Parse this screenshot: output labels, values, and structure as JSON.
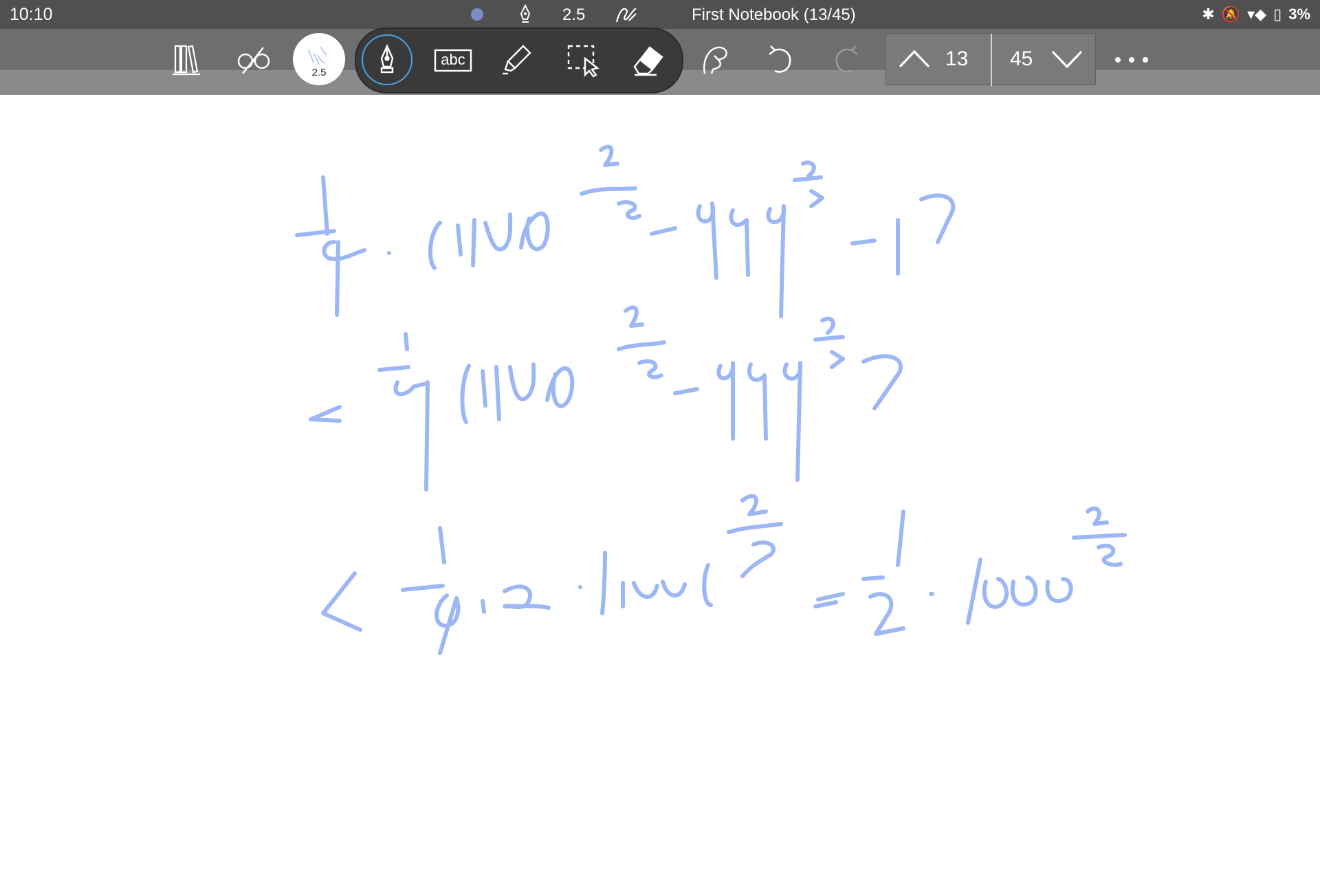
{
  "status_bar": {
    "time": "10:10",
    "pen_size": "2.5",
    "notebook_title": "First Notebook (13/45)",
    "battery": "3%",
    "icons": [
      "dot-indicator",
      "pen-icon",
      "signature-icon",
      "bluetooth-icon",
      "bell-off-icon",
      "wifi-icon",
      "battery-icon"
    ]
  },
  "toolbar": {
    "pen_preview_value": "2.5",
    "text_tool_label": "abc",
    "icons": [
      "library-icon",
      "read-mode-icon",
      "pen-tool-icon",
      "text-tool-icon",
      "highlighter-icon",
      "lasso-select-icon",
      "eraser-icon",
      "hand-icon",
      "undo-icon",
      "redo-icon",
      "more-icon"
    ]
  },
  "pager": {
    "current_page": "13",
    "total_pages": "45"
  },
  "colors": {
    "ink": "#9db7f5",
    "active_ring": "#4aa3e6"
  }
}
